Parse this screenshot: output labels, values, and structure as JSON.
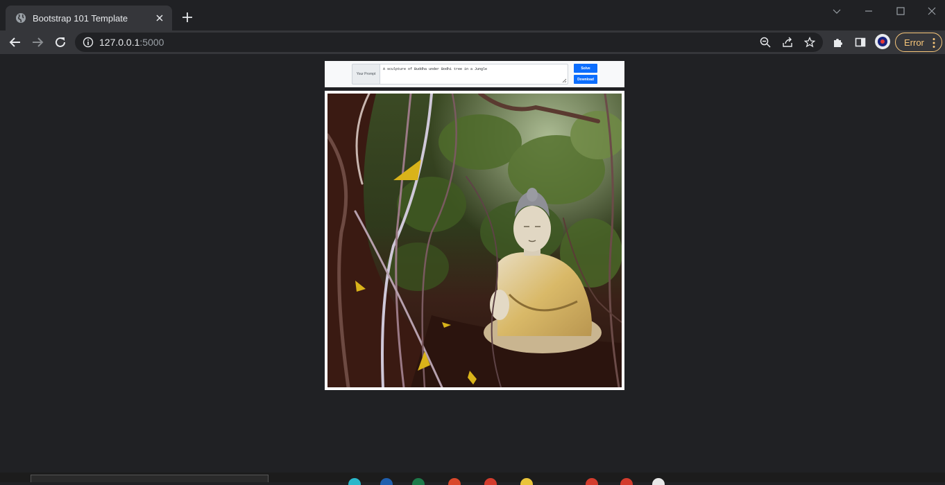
{
  "browser": {
    "tab": {
      "title": "Bootstrap 101 Template"
    },
    "address_bar": {
      "host": "127.0.0.1",
      "port": ":5000"
    },
    "profile_status": "Error"
  },
  "form": {
    "prompt_label": "Your Prompt",
    "prompt_value": "A sculpture of Buddha under Bodhi tree in a Jungle",
    "solve_label": "Solve",
    "download_label": "Download"
  },
  "colors": {
    "page_bg": "#202124",
    "primary_button": "#0d6efd",
    "error_accent": "#f9c77a"
  }
}
